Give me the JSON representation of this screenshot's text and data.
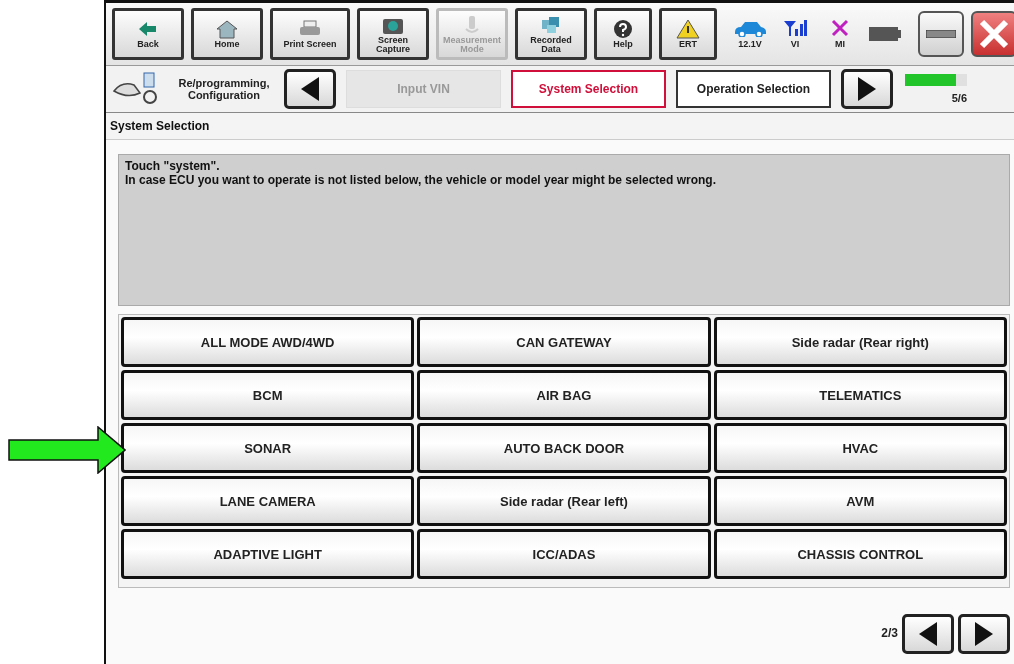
{
  "toolbar": [
    {
      "label": "Back",
      "kind": "back",
      "disabled": false
    },
    {
      "label": "Home",
      "kind": "home",
      "disabled": false
    },
    {
      "label": "Print Screen",
      "kind": "printer",
      "disabled": false
    },
    {
      "label": "Screen Capture",
      "kind": "camera",
      "disabled": false
    },
    {
      "label": "Measurement Mode",
      "kind": "meter",
      "disabled": true
    },
    {
      "label": "Recorded Data",
      "kind": "data",
      "disabled": false
    },
    {
      "label": "Help",
      "kind": "help",
      "disabled": false
    },
    {
      "label": "ERT",
      "kind": "warning",
      "disabled": false
    }
  ],
  "status": [
    {
      "label": "12.1V",
      "kind": "car"
    },
    {
      "label": "VI",
      "kind": "signal"
    },
    {
      "label": "MI",
      "kind": "cross"
    },
    {
      "kind": "battery"
    }
  ],
  "mode": {
    "label": "Re/programming, Configuration"
  },
  "steps": [
    {
      "label": "Input VIN",
      "selected": false,
      "disabled": true
    },
    {
      "label": "System Selection",
      "selected": true,
      "disabled": false
    },
    {
      "label": "Operation Selection",
      "selected": false,
      "disabled": false
    }
  ],
  "progress": {
    "label": "5/6",
    "level": 0.83
  },
  "section_title": "System Selection",
  "message": [
    "Touch \"system\".",
    "In case ECU you want to operate is not listed below, the vehicle or model year might be selected wrong."
  ],
  "systems": [
    {
      "label": "ALL MODE AWD/4WD",
      "pointed": false
    },
    {
      "label": "CAN GATEWAY",
      "pointed": false
    },
    {
      "label": "Side radar (Rear right)",
      "pointed": false
    },
    {
      "label": "BCM",
      "pointed": false
    },
    {
      "label": "AIR BAG",
      "pointed": false
    },
    {
      "label": "TELEMATICS",
      "pointed": false
    },
    {
      "label": "SONAR",
      "pointed": true
    },
    {
      "label": "AUTO BACK DOOR",
      "pointed": false
    },
    {
      "label": "HVAC",
      "pointed": false
    },
    {
      "label": "LANE CAMERA",
      "pointed": false
    },
    {
      "label": "Side radar (Rear left)",
      "pointed": false
    },
    {
      "label": "AVM",
      "pointed": false
    },
    {
      "label": "ADAPTIVE LIGHT",
      "pointed": false
    },
    {
      "label": "ICC/ADAS",
      "pointed": false
    },
    {
      "label": "CHASSIS CONTROL",
      "pointed": false
    }
  ],
  "pager": {
    "label": "2/3"
  }
}
